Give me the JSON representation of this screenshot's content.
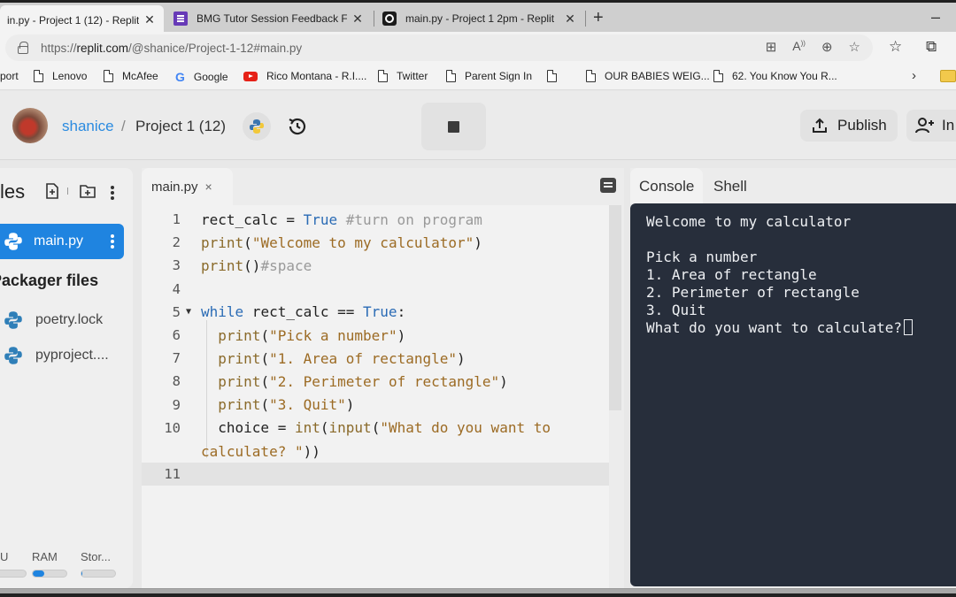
{
  "browser": {
    "tabs": [
      {
        "title": "in.py - Project 1 (12) - Replit",
        "active": true,
        "icon": "none"
      },
      {
        "title": "BMG Tutor Session Feedback Fo",
        "active": false,
        "icon": "google-forms-icon"
      },
      {
        "title": "main.py - Project 1 2pm - Replit",
        "active": false,
        "icon": "replit-icon"
      }
    ],
    "close_glyph": "✕",
    "new_tab_glyph": "+",
    "minimize_glyph": "–",
    "url_prefix": "https://",
    "url_host": "replit.com",
    "url_path": "/@shanice/Project-1-12#main.py",
    "omnibox_icons": [
      "app-available-icon",
      "read-aloud-icon",
      "zoom-icon",
      "add-favorite-icon"
    ],
    "toolbar_icons": [
      "favorites-icon",
      "collections-icon"
    ],
    "bookmarks": [
      {
        "label": "port",
        "icon": "none"
      },
      {
        "label": "Lenovo",
        "icon": "page-icon"
      },
      {
        "label": "McAfee",
        "icon": "page-icon"
      },
      {
        "label": "Google",
        "icon": "google-icon"
      },
      {
        "label": "Rico Montana - R.I....",
        "icon": "youtube-icon"
      },
      {
        "label": "Twitter",
        "icon": "page-icon"
      },
      {
        "label": "Parent Sign In",
        "icon": "page-icon"
      },
      {
        "label": "",
        "icon": "page-icon"
      },
      {
        "label": "OUR BABIES WEIG...",
        "icon": "page-icon"
      },
      {
        "label": "62. You Know You R...",
        "icon": "page-icon"
      }
    ],
    "bookmarks_more_glyph": "›"
  },
  "replit": {
    "header": {
      "username": "shanice",
      "separator": "/",
      "project_name": "Project 1 (12)",
      "publish_label": "Publish",
      "invite_label": "In"
    },
    "files": {
      "title": "les",
      "active_file": "main.py",
      "packager_title": "Packager files",
      "packager_items": [
        "poetry.lock",
        "pyproject...."
      ],
      "resources": [
        {
          "label": "U",
          "fill": 0.0
        },
        {
          "label": "RAM",
          "fill": 0.35
        },
        {
          "label": "Stor...",
          "fill": 0.03
        }
      ]
    },
    "editor": {
      "tab_label": "main.py",
      "tab_close": "×",
      "current_line": 11,
      "lines": [
        {
          "n": "1",
          "tokens": [
            [
              "",
              "rect_calc = "
            ],
            [
              "kw",
              "True"
            ],
            [
              "cm",
              " #turn on program"
            ]
          ]
        },
        {
          "n": "2",
          "tokens": [
            [
              "fn",
              "print"
            ],
            [
              "",
              "("
            ],
            [
              "str",
              "\"Welcome to my calculator\""
            ],
            [
              "",
              ")"
            ]
          ]
        },
        {
          "n": "3",
          "tokens": [
            [
              "fn",
              "print"
            ],
            [
              "",
              "()"
            ],
            [
              "cm",
              "#space"
            ]
          ]
        },
        {
          "n": "4",
          "tokens": []
        },
        {
          "n": "5",
          "fold": "▼",
          "tokens": [
            [
              "kw",
              "while"
            ],
            [
              "",
              " rect_calc == "
            ],
            [
              "kw",
              "True"
            ],
            [
              "",
              ":"
            ]
          ]
        },
        {
          "n": "6",
          "tokens": [
            [
              "",
              "  "
            ],
            [
              "fn",
              "print"
            ],
            [
              "",
              "("
            ],
            [
              "str",
              "\"Pick a number\""
            ],
            [
              "",
              ")"
            ]
          ]
        },
        {
          "n": "7",
          "tokens": [
            [
              "",
              "  "
            ],
            [
              "fn",
              "print"
            ],
            [
              "",
              "("
            ],
            [
              "str",
              "\"1. Area of rectangle\""
            ],
            [
              "",
              ")"
            ]
          ]
        },
        {
          "n": "8",
          "tokens": [
            [
              "",
              "  "
            ],
            [
              "fn",
              "print"
            ],
            [
              "",
              "("
            ],
            [
              "str",
              "\"2. Perimeter of rectangle\""
            ],
            [
              "",
              ")"
            ]
          ]
        },
        {
          "n": "9",
          "tokens": [
            [
              "",
              "  "
            ],
            [
              "fn",
              "print"
            ],
            [
              "",
              "("
            ],
            [
              "str",
              "\"3. Quit\""
            ],
            [
              "",
              ")"
            ]
          ]
        },
        {
          "n": "10",
          "tokens": [
            [
              "",
              "  choice = "
            ],
            [
              "fn",
              "int"
            ],
            [
              "",
              "("
            ],
            [
              "fn",
              "input"
            ],
            [
              "",
              "("
            ],
            [
              "str",
              "\"What do you want to"
            ]
          ]
        },
        {
          "n": "",
          "tokens": [
            [
              "str",
              "calculate? \""
            ],
            [
              "",
              "))"
            ]
          ]
        },
        {
          "n": "11",
          "tokens": []
        }
      ]
    },
    "console": {
      "tabs": [
        "Console",
        "Shell"
      ],
      "active_tab": "Console",
      "output": "Welcome to my calculator\n\nPick a number\n1. Area of rectangle\n2. Perimeter of rectangle\n3. Quit\nWhat do you want to calculate?"
    },
    "colors": {
      "accent": "#1f84e0",
      "console_bg": "#272e3b",
      "keyword": "#2a6bb5",
      "string": "#9c6b24",
      "comment": "#999999"
    }
  }
}
